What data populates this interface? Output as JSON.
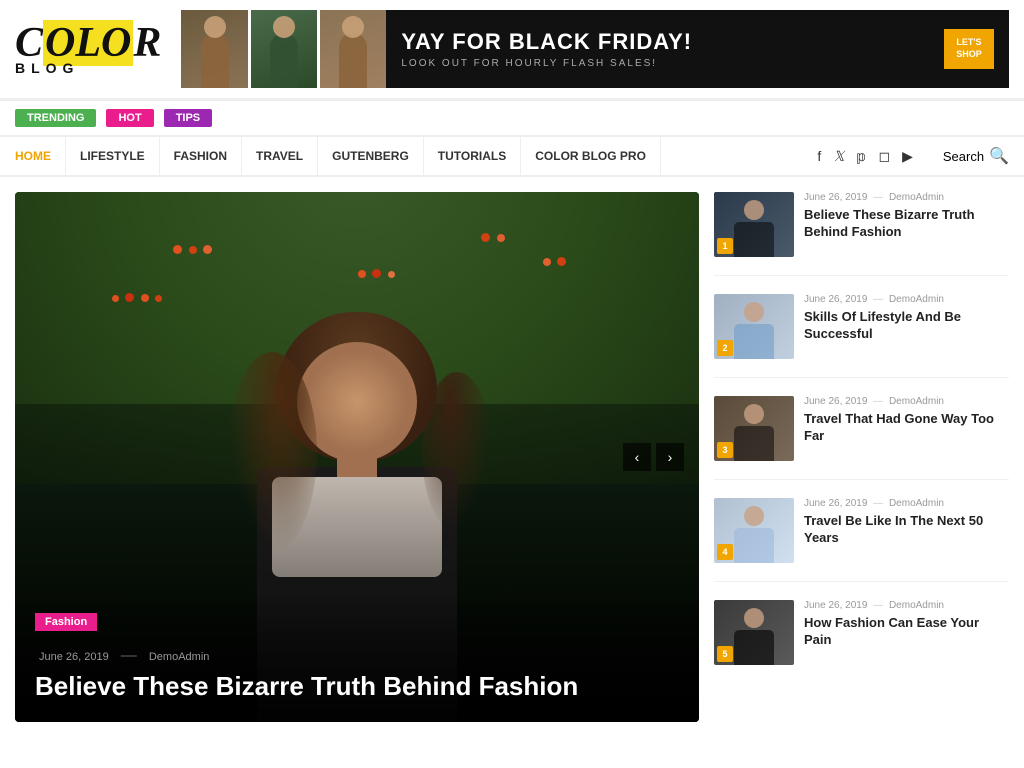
{
  "logo": {
    "color_text": "C",
    "olor_text": "OLOR",
    "blog_text": "BLOG",
    "full_color": "COLOR",
    "full_blog": "BLOG"
  },
  "banner": {
    "ad_title": "YAY FOR BLACK FRIDAY!",
    "ad_subtitle": "LOOK OUT FOR HOURLY FLASH SALES!",
    "ad_button": "LET'S SHOP"
  },
  "badges": [
    {
      "label": "TRENDING",
      "class": "badge-trending"
    },
    {
      "label": "HOT",
      "class": "badge-hot"
    },
    {
      "label": "TIPS",
      "class": "badge-tips"
    }
  ],
  "nav": {
    "items": [
      {
        "label": "HOME",
        "active": true
      },
      {
        "label": "LIFESTYLE",
        "active": false
      },
      {
        "label": "FASHION",
        "active": false
      },
      {
        "label": "TRAVEL",
        "active": false
      },
      {
        "label": "GUTENBERG",
        "active": false
      },
      {
        "label": "TUTORIALS",
        "active": false
      },
      {
        "label": "COLOR BLOG PRO",
        "active": false
      }
    ],
    "search_label": "Search"
  },
  "hero": {
    "category": "Fashion",
    "date": "June 26, 2019",
    "author": "DemoAdmin",
    "title": "Believe These Bizarre Truth Behind Fashion"
  },
  "sidebar_articles": [
    {
      "num": "1",
      "date": "June 26, 2019",
      "author": "DemoAdmin",
      "title": "Believe These Bizarre Truth Behind Fashion",
      "thumb_class": "thumb-1"
    },
    {
      "num": "2",
      "date": "June 26, 2019",
      "author": "DemoAdmin",
      "title": "Skills Of Lifestyle And Be Successful",
      "thumb_class": "thumb-2"
    },
    {
      "num": "3",
      "date": "June 26, 2019",
      "author": "DemoAdmin",
      "title": "Travel That Had Gone Way Too Far",
      "thumb_class": "thumb-3"
    },
    {
      "num": "4",
      "date": "June 26, 2019",
      "author": "DemoAdmin",
      "title": "Travel Be Like In The Next 50 Years",
      "thumb_class": "thumb-4"
    },
    {
      "num": "5",
      "date": "June 26, 2019",
      "author": "DemoAdmin",
      "title": "How Fashion Can Ease Your Pain",
      "thumb_class": "thumb-5"
    }
  ],
  "colors": {
    "accent_yellow": "#f0a500",
    "accent_pink": "#e91e8c",
    "accent_green": "#4CAF50",
    "accent_purple": "#9c27b0"
  }
}
